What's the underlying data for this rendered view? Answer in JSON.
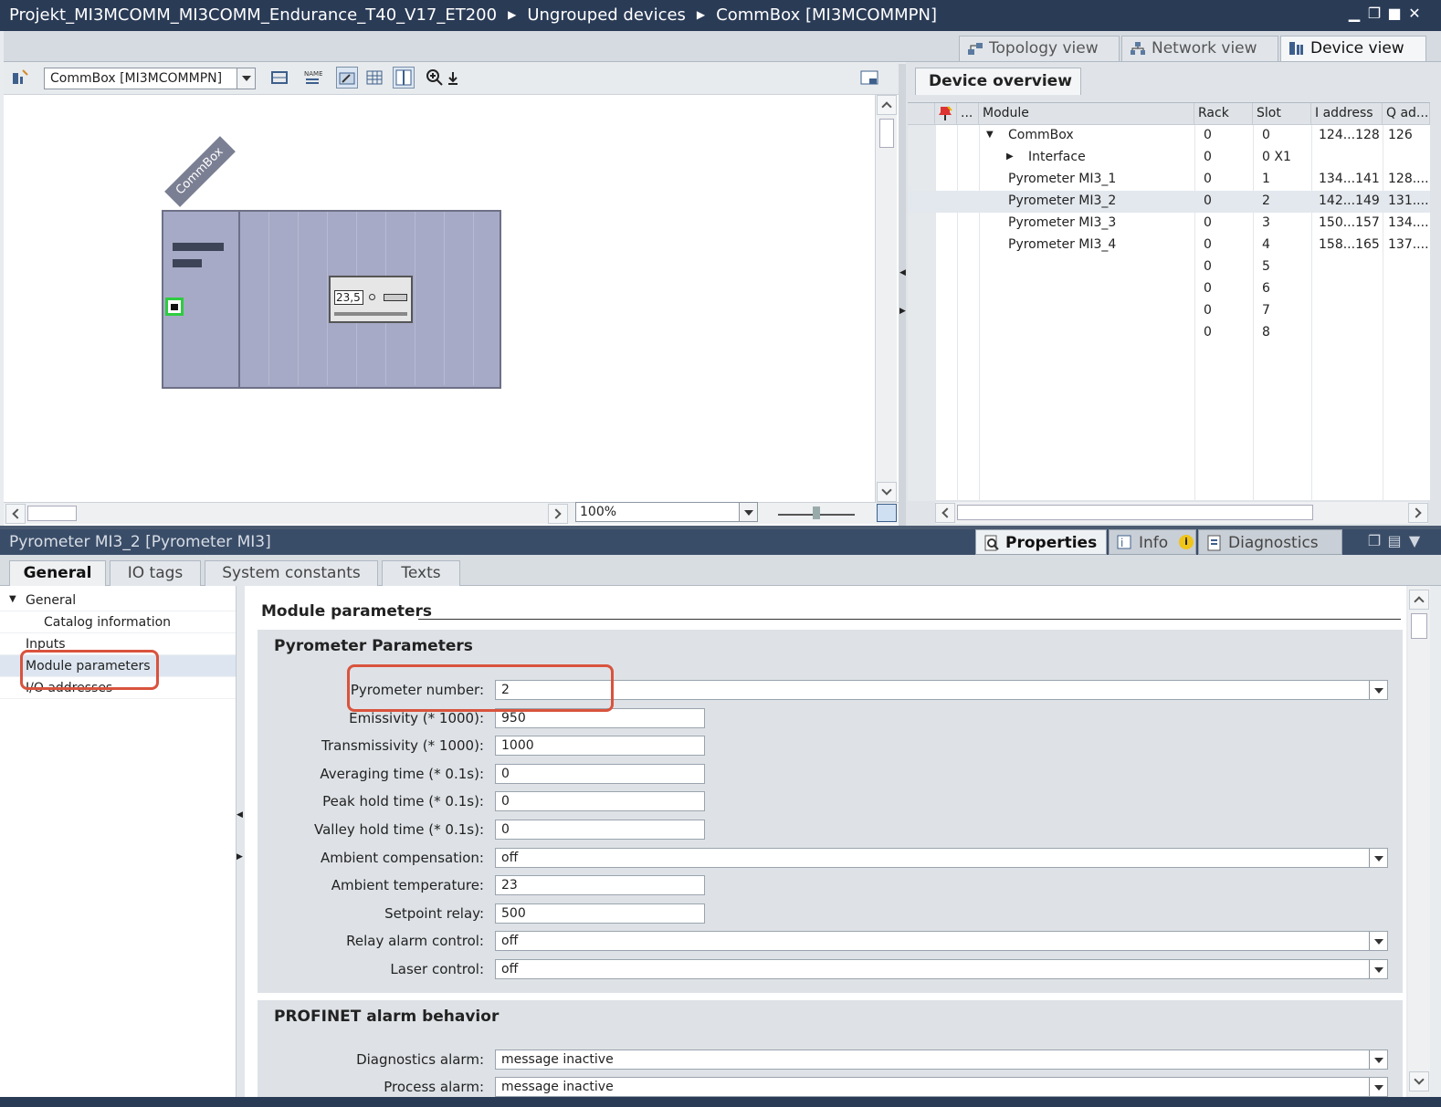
{
  "title_bar": {
    "crumbs": [
      "Projekt_MI3MCOMM_MI3COMM_Endurance_T40_V17_ET200",
      "Ungrouped devices",
      "CommBox [MI3MCOMMPN]"
    ]
  },
  "view_tabs": [
    "Topology view",
    "Network view",
    "Device view"
  ],
  "device_view": {
    "device_selector": "CommBox [MI3MCOMMPN]",
    "rack_label": "CommBox",
    "module_display": "23,5",
    "zoom": "100%"
  },
  "device_overview": {
    "tab_label": "Device overview",
    "columns": [
      "...",
      "Module",
      "Rack",
      "Slot",
      "I address",
      "Q ad..."
    ],
    "rows": [
      {
        "module": "CommBox",
        "rack": "0",
        "slot": "0",
        "i_address": "124...128",
        "q_address": "126",
        "expander": "expanded",
        "indent": 0
      },
      {
        "module": "Interface",
        "rack": "0",
        "slot": "0 X1",
        "i_address": "",
        "q_address": "",
        "expander": "collapsed",
        "indent": 1
      },
      {
        "module": "Pyrometer MI3_1",
        "rack": "0",
        "slot": "1",
        "i_address": "134...141",
        "q_address": "128....",
        "expander": "",
        "indent": 0
      },
      {
        "module": "Pyrometer MI3_2",
        "rack": "0",
        "slot": "2",
        "i_address": "142...149",
        "q_address": "131....",
        "expander": "",
        "indent": 0,
        "selected": true
      },
      {
        "module": "Pyrometer MI3_3",
        "rack": "0",
        "slot": "3",
        "i_address": "150...157",
        "q_address": "134....",
        "expander": "",
        "indent": 0
      },
      {
        "module": "Pyrometer MI3_4",
        "rack": "0",
        "slot": "4",
        "i_address": "158...165",
        "q_address": "137....",
        "expander": "",
        "indent": 0
      },
      {
        "module": "",
        "rack": "0",
        "slot": "5",
        "i_address": "",
        "q_address": "",
        "expander": "",
        "indent": 0
      },
      {
        "module": "",
        "rack": "0",
        "slot": "6",
        "i_address": "",
        "q_address": "",
        "expander": "",
        "indent": 0
      },
      {
        "module": "",
        "rack": "0",
        "slot": "7",
        "i_address": "",
        "q_address": "",
        "expander": "",
        "indent": 0
      },
      {
        "module": "",
        "rack": "0",
        "slot": "8",
        "i_address": "",
        "q_address": "",
        "expander": "",
        "indent": 0
      }
    ]
  },
  "inspector": {
    "title": "Pyrometer MI3_2 [Pyrometer MI3]",
    "tabs": [
      "Properties",
      "Info",
      "Diagnostics"
    ],
    "sub_tabs": [
      "General",
      "IO tags",
      "System constants",
      "Texts"
    ],
    "nav": [
      "General",
      "Catalog information",
      "Inputs",
      "Module parameters",
      "I/O addresses"
    ],
    "section_title": "Module parameters",
    "pyrometer_group": {
      "title": "Pyrometer Parameters",
      "fields": [
        {
          "label": "Pyrometer number:",
          "value": "2",
          "type": "dropdown"
        },
        {
          "label": "Emissivity (* 1000):",
          "value": "950",
          "type": "text"
        },
        {
          "label": "Transmissivity (* 1000):",
          "value": "1000",
          "type": "text"
        },
        {
          "label": "Averaging time (* 0.1s):",
          "value": "0",
          "type": "text"
        },
        {
          "label": "Peak hold time (* 0.1s):",
          "value": "0",
          "type": "text"
        },
        {
          "label": "Valley hold time (* 0.1s):",
          "value": "0",
          "type": "text"
        },
        {
          "label": "Ambient compensation:",
          "value": "off",
          "type": "dropdown"
        },
        {
          "label": "Ambient temperature:",
          "value": "23",
          "type": "text"
        },
        {
          "label": "Setpoint relay:",
          "value": "500",
          "type": "text"
        },
        {
          "label": "Relay alarm control:",
          "value": "off",
          "type": "dropdown"
        },
        {
          "label": "Laser control:",
          "value": "off",
          "type": "dropdown"
        }
      ]
    },
    "alarm_group": {
      "title": "PROFINET alarm behavior",
      "fields": [
        {
          "label": "Diagnostics alarm:",
          "value": "message inactive",
          "type": "dropdown"
        },
        {
          "label": "Process alarm:",
          "value": "message inactive",
          "type": "dropdown"
        }
      ]
    }
  },
  "colors": {
    "titlebar": "#2a3b56",
    "inspector_bar": "#3a4d68",
    "highlight": "#d9533d",
    "rack": "#a6aac6"
  }
}
